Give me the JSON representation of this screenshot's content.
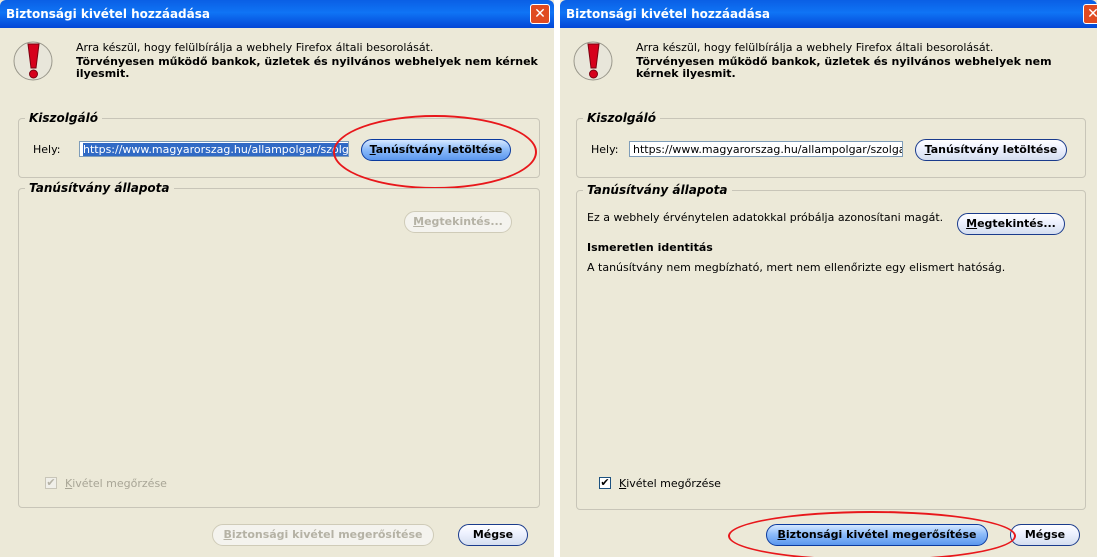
{
  "left_dialog": {
    "title": "Biztonsági kivétel hozzáadása",
    "close_glyph": "✕",
    "intro_line": "Arra készül, hogy felülbírálja a webhely Firefox általi besorolását.",
    "intro_bold": "Törvényesen működő bankok, üzletek és nyilvános webhelyek nem kérnek ilyesmit.",
    "server_legend": "Kiszolgáló",
    "location_label": "Hely:",
    "url_value": "https://www.magyarorszag.hu/allampolgar/szolgaltatasok",
    "get_cert_prefix": "T",
    "get_cert_rest": "anúsítvány letöltése",
    "status_legend": "Tanúsítvány állapota",
    "view_prefix": "M",
    "view_rest": "egtekintés...",
    "keep_prefix": "K",
    "keep_rest": "ivétel megőrzése",
    "confirm_prefix": "B",
    "confirm_rest": "iztonsági kivétel megerősítése",
    "cancel_label": "Mégse"
  },
  "right_dialog": {
    "title": "Biztonsági kivétel hozzáadása",
    "close_glyph": "✕",
    "intro_line": "Arra készül, hogy felülbírálja a webhely Firefox általi besorolását.",
    "intro_bold": "Törvényesen működő bankok, üzletek és nyilvános webhelyek nem kérnek ilyesmit.",
    "server_legend": "Kiszolgáló",
    "location_label": "Hely:",
    "url_value": "https://www.magyarorszag.hu/allampolgar/szolgaltatasok",
    "get_cert_prefix": "T",
    "get_cert_rest": "anúsítvány letöltése",
    "status_legend": "Tanúsítvány állapota",
    "status_text": "Ez a webhely érvénytelen adatokkal próbálja azonosítani magát.",
    "view_prefix": "M",
    "view_rest": "egtekintés...",
    "identity_title": "Ismeretlen identitás",
    "identity_text": "A tanúsítvány nem megbízható, mert nem ellenőrizte egy elismert hatóság.",
    "keep_prefix": "K",
    "keep_rest": "ivétel megőrzése",
    "checkmark": "✔",
    "confirm_prefix": "B",
    "confirm_rest": "iztonsági kivétel megerősítése",
    "cancel_label": "Mégse"
  },
  "colors": {
    "annotation_red": "#e8171b",
    "titlebar_blue": "#0a5fe5",
    "dialog_bg": "#ece9d8"
  }
}
